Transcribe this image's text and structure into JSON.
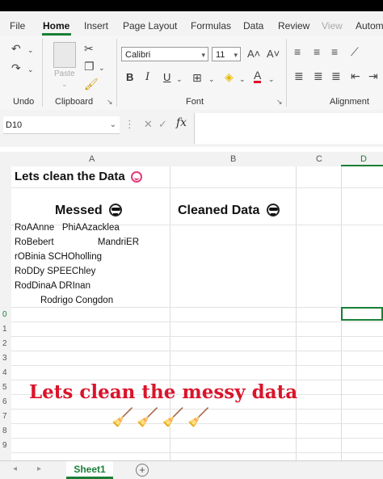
{
  "ribbon_tabs": [
    "File",
    "Home",
    "Insert",
    "Page Layout",
    "Formulas",
    "Data",
    "Review",
    "View",
    "Autom"
  ],
  "active_tab": "Home",
  "groups": {
    "undo": "Undo",
    "clipboard": "Clipboard",
    "font": "Font",
    "alignment": "Alignment"
  },
  "clipboard": {
    "paste_label": "Paste"
  },
  "font": {
    "name": "Calibri",
    "size": "11",
    "grow": "A˄",
    "shrink": "A˅",
    "bold": "B",
    "italic": "I",
    "underline": "U"
  },
  "formula_bar": {
    "name_box": "D10",
    "fx": "fx",
    "content": ""
  },
  "columns": [
    "A",
    "B",
    "C",
    "D"
  ],
  "rows": [
    "0",
    "1",
    "2",
    "3",
    "4",
    "5",
    "6",
    "7",
    "8",
    "9"
  ],
  "cells": {
    "title": "Lets clean the Data",
    "messed_header": "Messed",
    "cleaned_header": "Cleaned Data",
    "names": [
      "RoAAnne   PhiAAzacklea",
      "RoBebert                 MandriER",
      "rOBinia SCHOholling",
      "RoDDy SPEEChley",
      "RodDinaA DRInan",
      "          Rodrigo Congdon"
    ]
  },
  "overlay": {
    "text": "Lets clean the messy data",
    "brooms": "🧹🧹🧹🧹"
  },
  "sheet": {
    "name": "Sheet1",
    "add": "+"
  },
  "colors": {
    "accent": "#1a7f37",
    "overlay_red": "#d9142b"
  }
}
